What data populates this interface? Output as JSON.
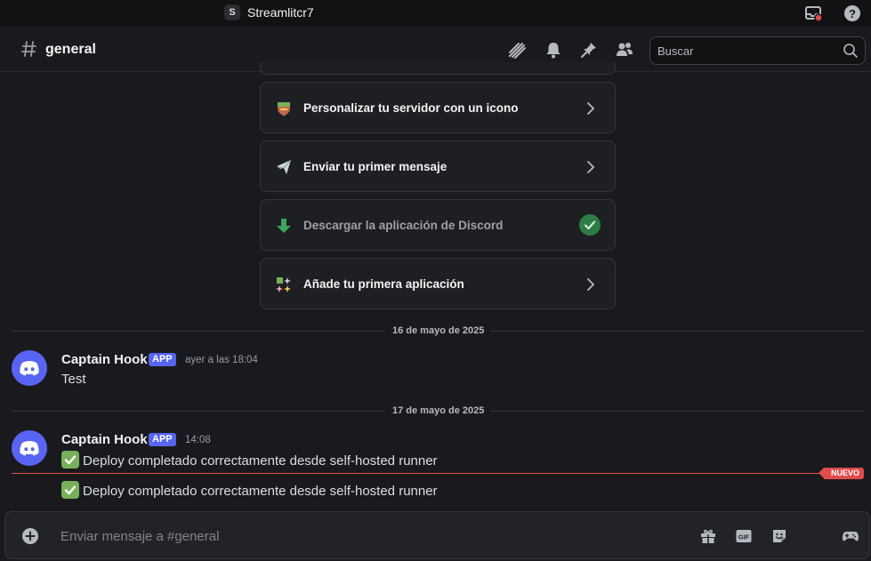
{
  "titlebar": {
    "server_badge": "S",
    "server_name": "Streamlitcr7",
    "icons": [
      "inbox-icon",
      "help-icon"
    ]
  },
  "header": {
    "channel_name": "general",
    "icons": [
      "threads-icon",
      "notification-bell-icon",
      "pin-icon",
      "member-list-icon"
    ],
    "search_placeholder": "Buscar"
  },
  "checklist": [
    {
      "label": "Personalizar tu servidor con un icono",
      "emoji": "shield-emoji",
      "done": false
    },
    {
      "label": "Enviar tu primer mensaje",
      "emoji": "paper-plane-emoji",
      "done": false
    },
    {
      "label": "Descargar la aplicación de Discord",
      "emoji": "down-arrow-emoji",
      "done": true
    },
    {
      "label": "Añade tu primera aplicación",
      "emoji": "sparkle-blocks-emoji",
      "done": false
    }
  ],
  "messages": {
    "date1": "16 de mayo de 2025",
    "msg1": {
      "author": "Captain Hook",
      "tag": "APP",
      "time": "ayer a las 18:04",
      "text": "Test"
    },
    "date2": "17 de mayo de 2025",
    "msg2": {
      "author": "Captain Hook",
      "tag": "APP",
      "time": "14:08",
      "text": "Deploy completado correctamente desde self-hosted runner"
    },
    "new_badge": "NUEVO",
    "msg3": {
      "text": "Deploy completado correctamente desde self-hosted runner"
    }
  },
  "composer": {
    "placeholder": "Enviar mensaje a #general",
    "icons": [
      "gift-icon",
      "gif-icon",
      "sticker-icon",
      "activity-icon"
    ]
  },
  "colors": {
    "accent": "#5865f2",
    "new_marker": "#e04b4b",
    "success": "#2d7d46",
    "check_emoji": "#78b159"
  }
}
